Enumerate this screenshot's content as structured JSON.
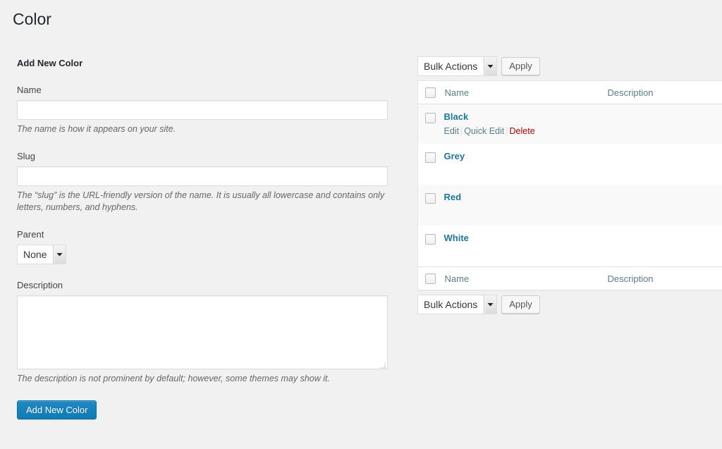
{
  "page": {
    "title": "Color"
  },
  "form": {
    "heading": "Add New Color",
    "fields": {
      "name": {
        "label": "Name",
        "value": "",
        "placeholder": "",
        "description": "The name is how it appears on your site."
      },
      "slug": {
        "label": "Slug",
        "value": "",
        "placeholder": "",
        "description": "The “slug” is the URL-friendly version of the name. It is usually all lowercase and contains only letters, numbers, and hyphens."
      },
      "parent": {
        "label": "Parent",
        "selected": "None",
        "options": [
          "None"
        ],
        "arrow_icon": "chevron-down-icon"
      },
      "description": {
        "label": "Description",
        "value": "",
        "placeholder": "",
        "description": "The description is not prominent by default; however, some themes may show it."
      }
    },
    "submit_label": "Add New Color"
  },
  "list": {
    "bulk_actions": {
      "selected": "Bulk Actions",
      "options": [
        "Bulk Actions"
      ],
      "apply_label": "Apply",
      "arrow_icon": "chevron-down-icon"
    },
    "columns": {
      "checkbox": "select-all-checkbox",
      "name": "Name",
      "description": "Description"
    },
    "rows": [
      {
        "name": "Black",
        "description": "",
        "actions": [
          {
            "label": "Edit",
            "kind": "edit"
          },
          {
            "label": "Quick Edit",
            "kind": "quick-edit"
          },
          {
            "label": "Delete",
            "kind": "delete"
          }
        ]
      },
      {
        "name": "Grey",
        "description": "",
        "actions": []
      },
      {
        "name": "Red",
        "description": "",
        "actions": []
      },
      {
        "name": "White",
        "description": "",
        "actions": []
      }
    ]
  },
  "colors": {
    "background": "#f1f1f1",
    "accent_blue": "#0e76a8",
    "link_blue": "#21759b",
    "muted_link": "#5b7c8d",
    "delete_red": "#a00000",
    "table_alt_row": "#f9f9f9",
    "border": "#e5e5e5"
  }
}
